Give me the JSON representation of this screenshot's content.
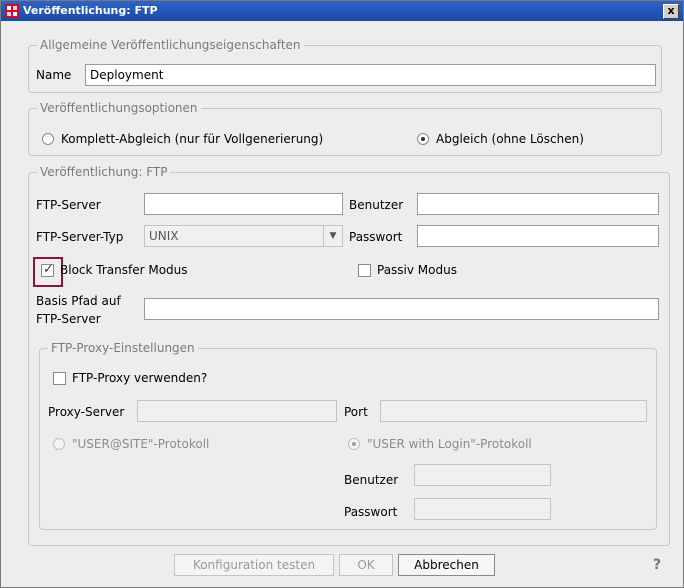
{
  "window": {
    "title": "Veröffentlichung: FTP",
    "close_label": "x"
  },
  "general": {
    "legend": "Allgemeine Veröffentlichungseigenschaften",
    "name_label": "Name",
    "name_value": "Deployment"
  },
  "options": {
    "legend": "Veröffentlichungsoptionen",
    "radio_full": "Komplett-Abgleich (nur für Vollgenerierung)",
    "radio_sync": "Abgleich (ohne Löschen)",
    "selected": "radio_sync"
  },
  "ftp": {
    "legend": "Veröffentlichung: FTP",
    "server_label": "FTP-Server",
    "server_value": "",
    "user_label": "Benutzer",
    "user_value": "",
    "server_type_label": "FTP-Server-Typ",
    "server_type_value": "UNIX",
    "password_label": "Passwort",
    "password_value": "",
    "block_transfer_label": "Block Transfer Modus",
    "block_transfer_checked": true,
    "passive_label": "Passiv Modus",
    "passive_checked": false,
    "base_path_label_line1": "Basis Pfad auf",
    "base_path_label_line2": "FTP-Server",
    "base_path_value": ""
  },
  "proxy": {
    "legend": "FTP-Proxy-Einstellungen",
    "use_proxy_label": "FTP-Proxy verwenden?",
    "use_proxy_checked": false,
    "server_label": "Proxy-Server",
    "port_label": "Port",
    "radio_user_site": "\"USER@SITE\"-Protokoll",
    "radio_user_login": "\"USER with Login\"-Protokoll",
    "selected": "radio_user_login",
    "user_label": "Benutzer",
    "password_label": "Passwort"
  },
  "buttons": {
    "test_config": "Konfiguration testen",
    "ok": "OK",
    "cancel": "Abbrechen",
    "help": "?"
  },
  "colors": {
    "titlebar": "#1c4aa6",
    "focus_outline": "#8a1538"
  }
}
